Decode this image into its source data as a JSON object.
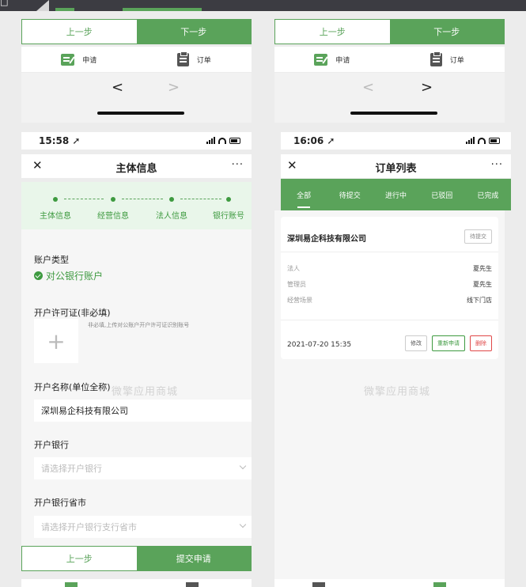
{
  "left": {
    "top_buttons": {
      "prev": "上一步",
      "next": "下一步"
    },
    "tabbar": [
      {
        "label": "申请",
        "icon": "apply-icon"
      },
      {
        "label": "订单",
        "icon": "order-icon"
      }
    ],
    "nav": {
      "back": "<",
      "forward": ">"
    },
    "status": {
      "time": "15:58",
      "location": "➚"
    },
    "header": {
      "close": "✕",
      "title": "主体信息",
      "more": "···"
    },
    "steps": [
      "主体信息",
      "经营信息",
      "法人信息",
      "银行账号"
    ],
    "form": {
      "account_type_label": "账户类型",
      "account_type_value": "对公银行账户",
      "license_label": "开户许可证(非必填)",
      "license_hint": "非必填,上传对公账户开户许可证识别账号",
      "upload_plus": "+",
      "account_name_label": "开户名称(单位全称)",
      "watermark": "微擎应用商城",
      "account_name_value": "深圳易企科技有限公司",
      "bank_label": "开户银行",
      "bank_placeholder": "请选择开户银行",
      "bank_city_label": "开户银行省市",
      "bank_city_placeholder": "请选择开户银行支行省市"
    },
    "bottom_buttons": {
      "prev": "上一步",
      "submit": "提交申请"
    }
  },
  "right": {
    "top_buttons": {
      "prev": "上一步",
      "next": "下一步"
    },
    "tabbar": [
      {
        "label": "申请",
        "icon": "apply-icon"
      },
      {
        "label": "订单",
        "icon": "order-icon"
      }
    ],
    "nav": {
      "back": "<",
      "forward": ">"
    },
    "status": {
      "time": "16:06",
      "location": "➚"
    },
    "header": {
      "close": "✕",
      "title": "订单列表",
      "more": "···"
    },
    "order_tabs": [
      "全部",
      "待提交",
      "进行中",
      "已驳回",
      "已完成"
    ],
    "card": {
      "company": "深圳易企科技有限公司",
      "badge": "待提交",
      "rows": [
        {
          "k": "法人",
          "v": "夏先生"
        },
        {
          "k": "管理员",
          "v": "夏先生"
        },
        {
          "k": "经营场景",
          "v": "线下门店"
        }
      ],
      "date": "2021-07-20 15:35",
      "actions": {
        "edit": "修改",
        "renew": "重新申请",
        "delete": "删除"
      }
    },
    "watermark": "微擎应用商城"
  },
  "colors": {
    "primary": "#5aa35a",
    "danger": "#e04848",
    "step_bg": "#e9f6ea"
  }
}
